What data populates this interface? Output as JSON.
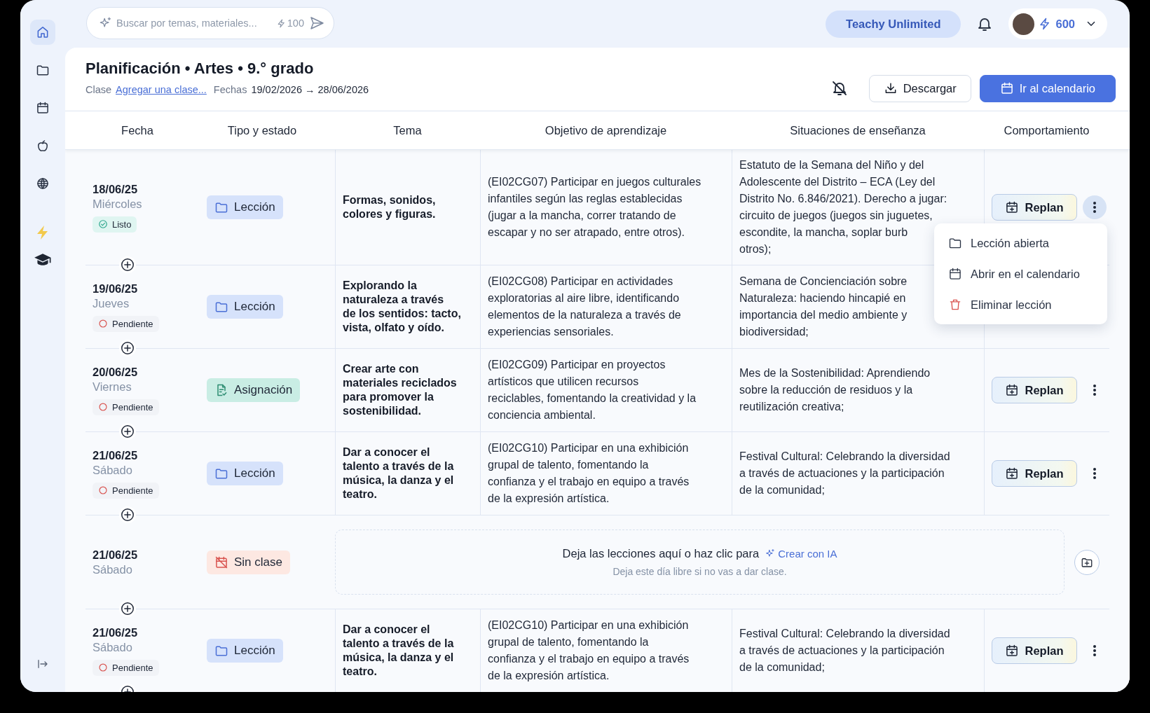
{
  "sidebar": {
    "items": [
      {
        "selected": true
      },
      {
        "selected": false
      },
      {
        "selected": false
      },
      {
        "selected": false
      },
      {
        "selected": false
      }
    ]
  },
  "topbar": {
    "search": {
      "placeholder": "Buscar por temas, materiales...",
      "cost": "100"
    },
    "plan": "Teachy Unlimited",
    "credits": "600"
  },
  "header": {
    "title": "Planificación • Artes • 9.° grado",
    "class_label": "Clase",
    "class_link": "Agregar una clase...",
    "dates_label": "Fechas",
    "dates": "19/02/2026 → 28/06/2026",
    "buttons": [
      {
        "label": "Descargar",
        "kind": "outline"
      },
      {
        "label": "Ir al calendario",
        "kind": "primary"
      }
    ]
  },
  "table": {
    "columns": [
      "Fecha",
      "Tipo y estado",
      "Tema",
      "Objetivo de aprendizaje",
      "Situaciones de enseñanza",
      "Comportamiento"
    ],
    "rows": [
      {
        "kind": "planned",
        "date": "18/06/25",
        "day": "Miércoles",
        "status": {
          "label": "Listo",
          "kind": "done"
        },
        "type": {
          "label": "Lección",
          "kind": "lesson"
        },
        "tema": [
          "Formas, sonidos,",
          "colores y figuras."
        ],
        "objetivo": [
          "(EI02CG07) Participar en juegos culturales",
          "infantiles según las reglas establecidas",
          "(jugar a la mancha, correr tratando de",
          "escapar y no ser atrapado, entre otros)."
        ],
        "situacion": [
          "Estatuto de la Semana del Niño y del",
          "Adolescente del Distrito – ECA (Ley del",
          "Distrito No. 6.846/2021). Derecho a jugar:",
          "circuito de juegos (juegos sin juguetes,",
          "escondite, la mancha, soplar burb",
          "otros);"
        ],
        "replan": "Replan",
        "menu_open": true,
        "menu": [
          {
            "label": "Lección abierta",
            "kind": "open"
          },
          {
            "label": "Abrir en el calendario",
            "kind": "calendar"
          },
          {
            "label": "Eliminar lección",
            "kind": "delete"
          }
        ]
      },
      {
        "kind": "planned",
        "date": "19/06/25",
        "day": "Jueves",
        "status": {
          "label": "Pendiente",
          "kind": "pending"
        },
        "type": {
          "label": "Lección",
          "kind": "lesson"
        },
        "tema": [
          "Explorando la",
          "naturaleza a través",
          "de los sentidos: tacto,",
          "vista, olfato y oído."
        ],
        "objetivo": [
          "(EI02CG08) Participar en actividades",
          "exploratorias al aire libre, identificando",
          "elementos de la naturaleza a través de",
          "experiencias sensoriales."
        ],
        "situacion": [
          "Semana de Concienciación sobre",
          "Naturaleza: haciendo hincapié en",
          "importancia del medio ambiente y",
          "biodiversidad;"
        ]
      },
      {
        "kind": "planned",
        "date": "20/06/25",
        "day": "Viernes",
        "status": {
          "label": "Pendiente",
          "kind": "pending"
        },
        "type": {
          "label": "Asignación",
          "kind": "assignment"
        },
        "tema": [
          "Crear arte con",
          "materiales reciclados",
          "para promover la",
          "sostenibilidad."
        ],
        "objetivo": [
          "(EI02CG09) Participar en proyectos",
          "artísticos que utilicen recursos",
          "reciclables, fomentando la creatividad y la",
          "conciencia ambiental."
        ],
        "situacion": [
          "Mes de la Sostenibilidad: Aprendiendo",
          "sobre la reducción de residuos y la",
          "reutilización creativa;"
        ],
        "replan": "Replan",
        "menu_open": false
      },
      {
        "kind": "planned",
        "date": "21/06/25",
        "day": "Sábado",
        "status": {
          "label": "Pendiente",
          "kind": "pending"
        },
        "type": {
          "label": "Lección",
          "kind": "lesson"
        },
        "tema": [
          "Dar a conocer el",
          "talento a través de la",
          "música, la danza y el",
          "teatro."
        ],
        "objetivo": [
          "(EI02CG10) Participar en una exhibición",
          "grupal de talento, fomentando la",
          "confianza y el trabajo en equipo a través",
          "de la expresión artística."
        ],
        "situacion": [
          "Festival Cultural: Celebrando la diversidad",
          "a través de actuaciones y la participación",
          "de la comunidad;"
        ],
        "replan": "Replan",
        "menu_open": false
      },
      {
        "kind": "free",
        "date": "21/06/25",
        "day": "Sábado",
        "type": {
          "label": "Sin clase",
          "kind": "noclass"
        },
        "drop": {
          "text": "Deja las lecciones aquí o haz clic para",
          "link": "Crear con IA",
          "hint": "Deja este día libre si no vas a dar clase."
        }
      },
      {
        "kind": "planned",
        "date": "21/06/25",
        "day": "Sábado",
        "status": {
          "label": "Pendiente",
          "kind": "pending"
        },
        "type": {
          "label": "Lección",
          "kind": "lesson"
        },
        "tema": [
          "Dar a conocer el",
          "talento a través de la",
          "música, la danza y el",
          "teatro."
        ],
        "objetivo": [
          "(EI02CG10) Participar en una exhibición",
          "grupal de talento, fomentando la",
          "confianza y el trabajo en equipo a través",
          "de la expresión artística."
        ],
        "situacion": [
          "Festival Cultural: Celebrando la diversidad",
          "a través de actuaciones y la participación",
          "de la comunidad;"
        ],
        "replan": "Replan",
        "menu_open": false
      }
    ]
  }
}
